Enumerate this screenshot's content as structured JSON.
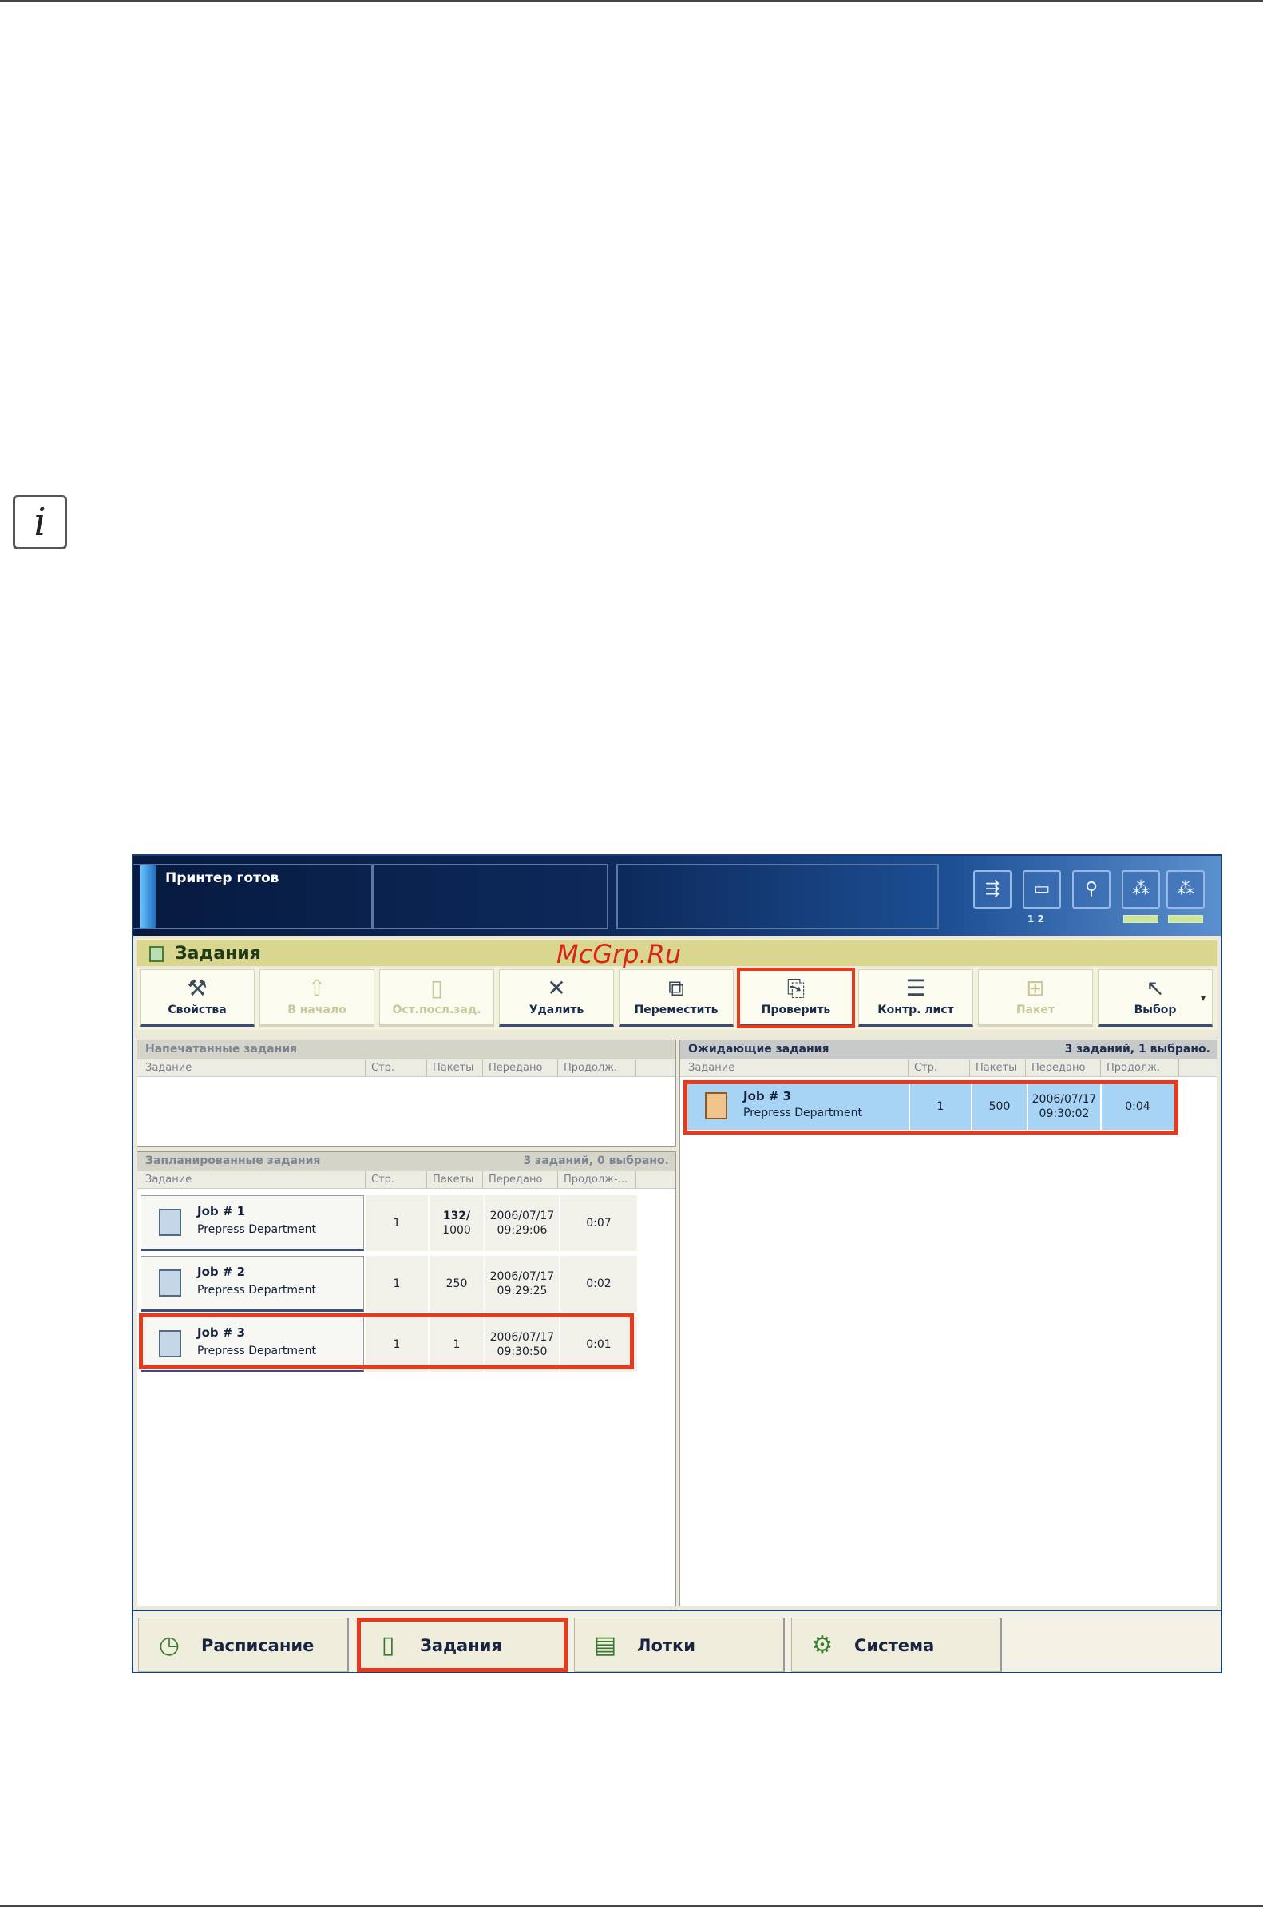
{
  "statusbar": {
    "status": "Принтер готов",
    "icons": [
      "delivery-icon",
      "tray-icon",
      "wrench-icon",
      "toner-icon-1",
      "toner-icon-2"
    ],
    "tray_numbers": "1  2"
  },
  "section": {
    "title": "Задания"
  },
  "watermark": "McGrp.Ru",
  "toolbar": {
    "properties": "Свойства",
    "to_top": "В начало",
    "stop_after": "Ост.посл.зад.",
    "delete": "Удалить",
    "move": "Переместить",
    "proof": "Проверить",
    "control_sheet": "Контр. лист",
    "batch": "Пакет",
    "select": "Выбор"
  },
  "printed": {
    "title": "Напечатанные задания",
    "columns": [
      "Задание",
      "Стр.",
      "Пакеты",
      "Передано",
      "Продолж."
    ]
  },
  "scheduled": {
    "title": "Запланированные задания",
    "count": "3 заданий, 0 выбрано.",
    "columns": [
      "Задание",
      "Стр.",
      "Пакеты",
      "Передано",
      "Продолж-..."
    ],
    "jobs": [
      {
        "name": "Job # 1",
        "dept": "Prepress Department",
        "pages": "1",
        "sets_top": "132/",
        "sets_bottom": "1000",
        "date": "2006/07/17",
        "time": "09:29:06",
        "duration": "0:07"
      },
      {
        "name": "Job # 2",
        "dept": "Prepress Department",
        "pages": "1",
        "sets_top": "250",
        "sets_bottom": "",
        "date": "2006/07/17",
        "time": "09:29:25",
        "duration": "0:02"
      },
      {
        "name": "Job # 3",
        "dept": "Prepress Department",
        "pages": "1",
        "sets_top": "1",
        "sets_bottom": "",
        "date": "2006/07/17",
        "time": "09:30:50",
        "duration": "0:01"
      }
    ]
  },
  "waiting": {
    "title": "Ожидающие задания",
    "count": "3 заданий, 1 выбрано.",
    "columns": [
      "Задание",
      "Стр.",
      "Пакеты",
      "Передано",
      "Продолж."
    ],
    "jobs": [
      {
        "name": "Job # 3",
        "dept": "Prepress Department",
        "pages": "1",
        "sets": "500",
        "date": "2006/07/17",
        "time": "09:30:02",
        "duration": "0:04"
      }
    ]
  },
  "tabs": {
    "schedule": "Расписание",
    "jobs": "Задания",
    "trays": "Лотки",
    "system": "Система"
  },
  "colors": {
    "highlight": "#e8391d",
    "selected_row": "#a7d4f4",
    "title_bar": "#d9d78f"
  }
}
